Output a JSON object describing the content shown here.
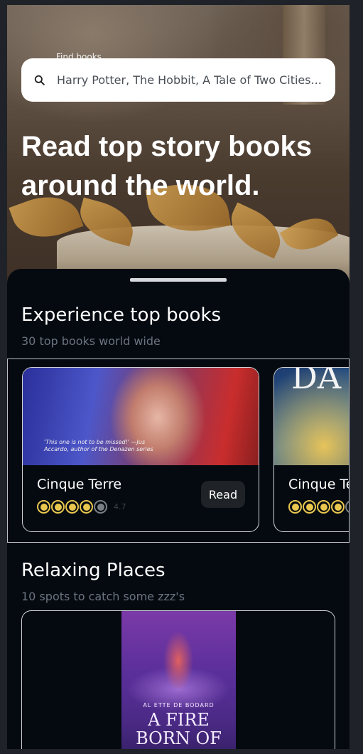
{
  "search": {
    "caption": "Find books...",
    "placeholder": "Harry Potter, The Hobbit, A Tale of Two Cities..."
  },
  "hero": {
    "title": "Read top story books around the world."
  },
  "sections": {
    "top_books": {
      "title": "Experience top books",
      "subtitle": "30 top books world wide",
      "cards": [
        {
          "name": "Cinque Terre",
          "cover_quote": "'This one is not to be missed!' —Jus Accardo, author of the Denazen series",
          "stars_filled": 4,
          "stars_total": 5,
          "rating": "4.7",
          "read_label": "Read"
        },
        {
          "name": "Cinque Te",
          "cover_text": "DA",
          "stars_filled": 4,
          "stars_total": 5
        }
      ]
    },
    "relaxing": {
      "title": "Relaxing Places",
      "subtitle": "10 spots to catch some zzz's",
      "cover_author": "AL ETTE DE BODARD",
      "cover_title": "A FIRE BORN OF"
    }
  },
  "colors": {
    "background": "#050a11",
    "star_active": "#e9c74e",
    "star_inactive": "#7a7f86"
  }
}
